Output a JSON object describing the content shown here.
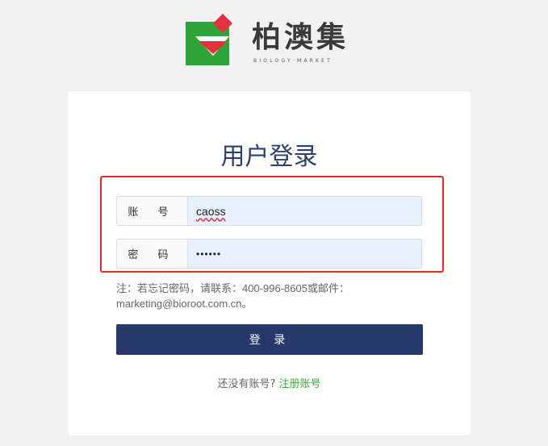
{
  "brand": {
    "name": "柏澳集",
    "subtitle": "BIOLOGY·MARKET"
  },
  "login": {
    "title": "用户登录",
    "account_label": "账 号",
    "account_value": "caoss",
    "password_label": "密 码",
    "password_value": "••••••",
    "note": "注：若忘记密码，请联系：400-996-8605或邮件：marketing@bioroot.com.cn。",
    "submit_label": "登 录",
    "register_prompt": "还没有账号?",
    "register_link": "注册账号"
  },
  "colors": {
    "primary": "#27396b",
    "title": "#2c3f6e",
    "highlight": "#e02a2a",
    "link": "#3aa83a",
    "input_bg": "#e8f0fe"
  },
  "icons": {
    "logo": "biology-market-logo-icon"
  }
}
